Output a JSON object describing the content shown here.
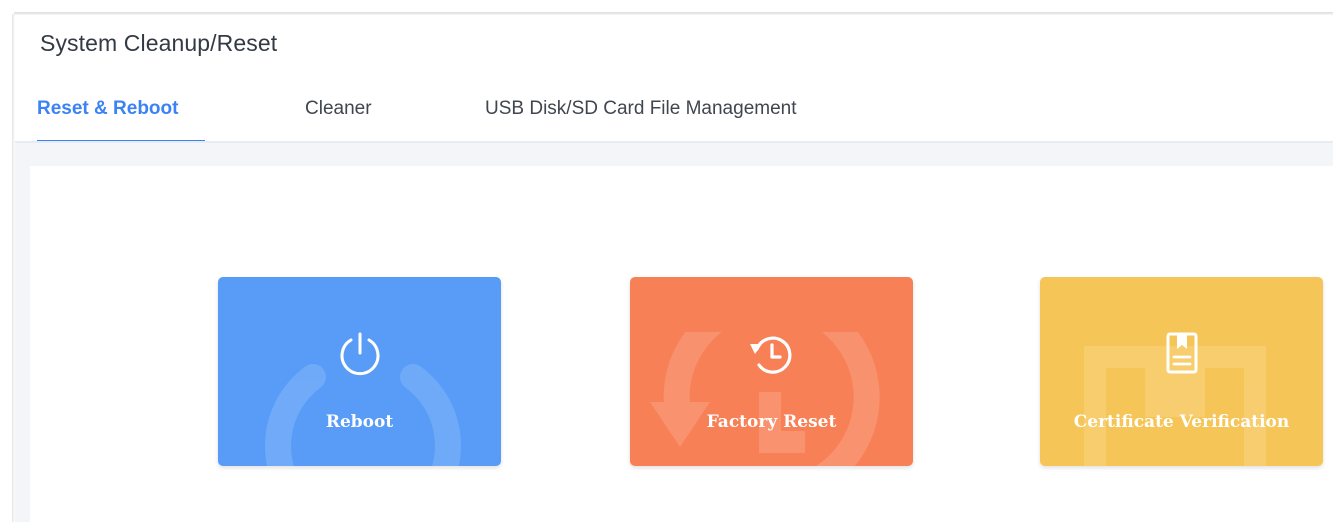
{
  "page": {
    "title": "System Cleanup/Reset"
  },
  "tabs": [
    {
      "label": "Reset & Reboot",
      "active": true
    },
    {
      "label": "Cleaner",
      "active": false
    },
    {
      "label": "USB Disk/SD Card File Management",
      "active": false
    }
  ],
  "cards": [
    {
      "label": "Reboot",
      "icon": "power-icon",
      "color": "#589cf7"
    },
    {
      "label": "Factory Reset",
      "icon": "history-icon",
      "color": "#f78057"
    },
    {
      "label": "Certificate Verification",
      "icon": "certificate-icon",
      "color": "#f6c557"
    }
  ],
  "colors": {
    "accent": "#3b82f6",
    "content_background": "#f3f5f8"
  }
}
